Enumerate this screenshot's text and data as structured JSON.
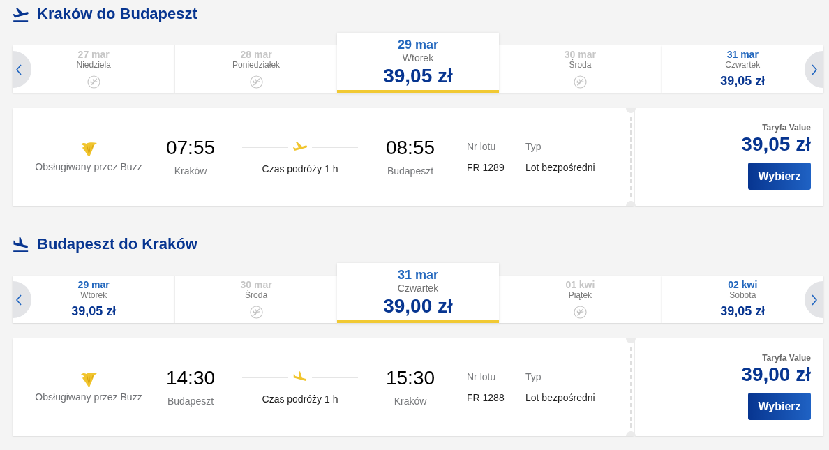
{
  "journeys": [
    {
      "kind": "outbound",
      "title": "Kraków do Budapeszt",
      "date_strip": {
        "days": [
          {
            "date": "27 mar",
            "weekday": "Niedziela",
            "available": false,
            "selected": false
          },
          {
            "date": "28 mar",
            "weekday": "Poniedziałek",
            "available": false,
            "selected": false
          },
          {
            "date": "29 mar",
            "weekday": "Wtorek",
            "price": "39,05 zł",
            "available": true,
            "selected": true
          },
          {
            "date": "30 mar",
            "weekday": "Środa",
            "available": false,
            "selected": false
          },
          {
            "date": "31 mar",
            "weekday": "Czwartek",
            "price": "39,05 zł",
            "available": true,
            "selected": false
          }
        ]
      },
      "flight": {
        "operator": "Obsługiwany przez Buzz",
        "departure": {
          "time": "07:55",
          "city": "Kraków"
        },
        "duration": "Czas podróży 1 h",
        "arrival": {
          "time": "08:55",
          "city": "Budapeszt"
        },
        "flight_number_label": "Nr lotu",
        "flight_number": "FR 1289",
        "type_label": "Typ",
        "type": "Lot bezpośredni",
        "fare_label": "Taryfa Value",
        "price": "39,05 zł",
        "button": "Wybierz"
      }
    },
    {
      "kind": "return",
      "title": "Budapeszt do Kraków",
      "date_strip": {
        "days": [
          {
            "date": "29 mar",
            "weekday": "Wtorek",
            "price": "39,05 zł",
            "available": true,
            "selected": false
          },
          {
            "date": "30 mar",
            "weekday": "Środa",
            "available": false,
            "selected": false
          },
          {
            "date": "31 mar",
            "weekday": "Czwartek",
            "price": "39,00 zł",
            "available": true,
            "selected": true
          },
          {
            "date": "01 kwi",
            "weekday": "Piątek",
            "available": false,
            "selected": false
          },
          {
            "date": "02 kwi",
            "weekday": "Sobota",
            "price": "39,05 zł",
            "available": true,
            "selected": false
          }
        ]
      },
      "flight": {
        "operator": "Obsługiwany przez Buzz",
        "departure": {
          "time": "14:30",
          "city": "Budapeszt"
        },
        "duration": "Czas podróży 1 h",
        "arrival": {
          "time": "15:30",
          "city": "Kraków"
        },
        "flight_number_label": "Nr lotu",
        "flight_number": "FR 1288",
        "type_label": "Typ",
        "type": "Lot bezpośredni",
        "fare_label": "Taryfa Value",
        "price": "39,00 zł",
        "button": "Wybierz"
      }
    }
  ]
}
